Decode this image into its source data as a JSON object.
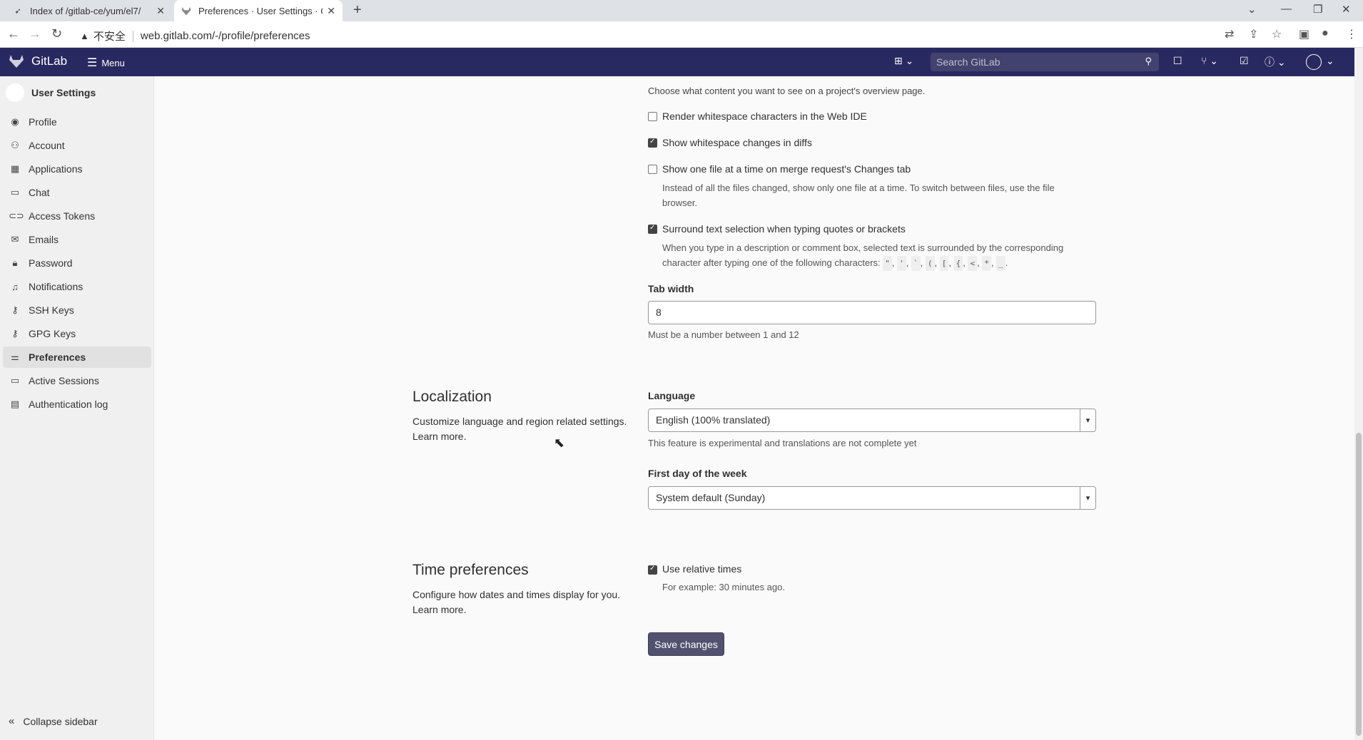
{
  "browser": {
    "tabs": [
      {
        "title": "Index of /gitlab-ce/yum/el7/",
        "active": false
      },
      {
        "title": "Preferences · User Settings · G",
        "active": true
      }
    ],
    "insecure_label": "不安全",
    "url": "web.gitlab.com/-/profile/preferences"
  },
  "header": {
    "brand": "GitLab",
    "menu_label": "Menu",
    "search_placeholder": "Search GitLab"
  },
  "sidebar": {
    "title": "User Settings",
    "items": [
      {
        "label": "Profile",
        "icon": "profile-icon"
      },
      {
        "label": "Account",
        "icon": "account-icon"
      },
      {
        "label": "Applications",
        "icon": "applications-icon"
      },
      {
        "label": "Chat",
        "icon": "chat-icon"
      },
      {
        "label": "Access Tokens",
        "icon": "token-icon"
      },
      {
        "label": "Emails",
        "icon": "mail-icon"
      },
      {
        "label": "Password",
        "icon": "lock-icon"
      },
      {
        "label": "Notifications",
        "icon": "bell-icon"
      },
      {
        "label": "SSH Keys",
        "icon": "key-icon"
      },
      {
        "label": "GPG Keys",
        "icon": "key-icon"
      },
      {
        "label": "Preferences",
        "icon": "preferences-icon",
        "active": true
      },
      {
        "label": "Active Sessions",
        "icon": "monitor-icon"
      },
      {
        "label": "Authentication log",
        "icon": "log-icon"
      }
    ],
    "collapse_label": "Collapse sidebar"
  },
  "behavior": {
    "overview_help": "Choose what content you want to see on a project's overview page.",
    "render_whitespace": {
      "label": "Render whitespace characters in the Web IDE",
      "checked": false
    },
    "show_whitespace": {
      "label": "Show whitespace changes in diffs",
      "checked": true
    },
    "one_file": {
      "label": "Show one file at a time on merge request's Changes tab",
      "checked": false,
      "help_1": "Instead of all the files changed, show only one file at a time. To switch between files, use the file",
      "help_2": "browser."
    },
    "surround": {
      "label": "Surround text selection when typing quotes or brackets",
      "checked": true,
      "help_1": "When you type in a description or comment box, selected text is surrounded by the corresponding",
      "help_2": "character after typing one of the following characters:",
      "chars": [
        "\"",
        "'",
        "`",
        "(",
        "[",
        "{",
        "<",
        "*",
        "_"
      ]
    },
    "tab_width": {
      "label": "Tab width",
      "value": "8",
      "help": "Must be a number between 1 and 12"
    }
  },
  "localization": {
    "title": "Localization",
    "desc": "Customize language and region related settings.",
    "learn_more": "Learn more.",
    "language_label": "Language",
    "language_value": "English (100% translated)",
    "language_help": "This feature is experimental and translations are not complete yet",
    "first_day_label": "First day of the week",
    "first_day_value": "System default (Sunday)"
  },
  "time": {
    "title": "Time preferences",
    "desc": "Configure how dates and times display for you.",
    "learn_more": "Learn more.",
    "relative": {
      "label": "Use relative times",
      "checked": true,
      "help": "For example: 30 minutes ago."
    }
  },
  "save_label": "Save changes"
}
